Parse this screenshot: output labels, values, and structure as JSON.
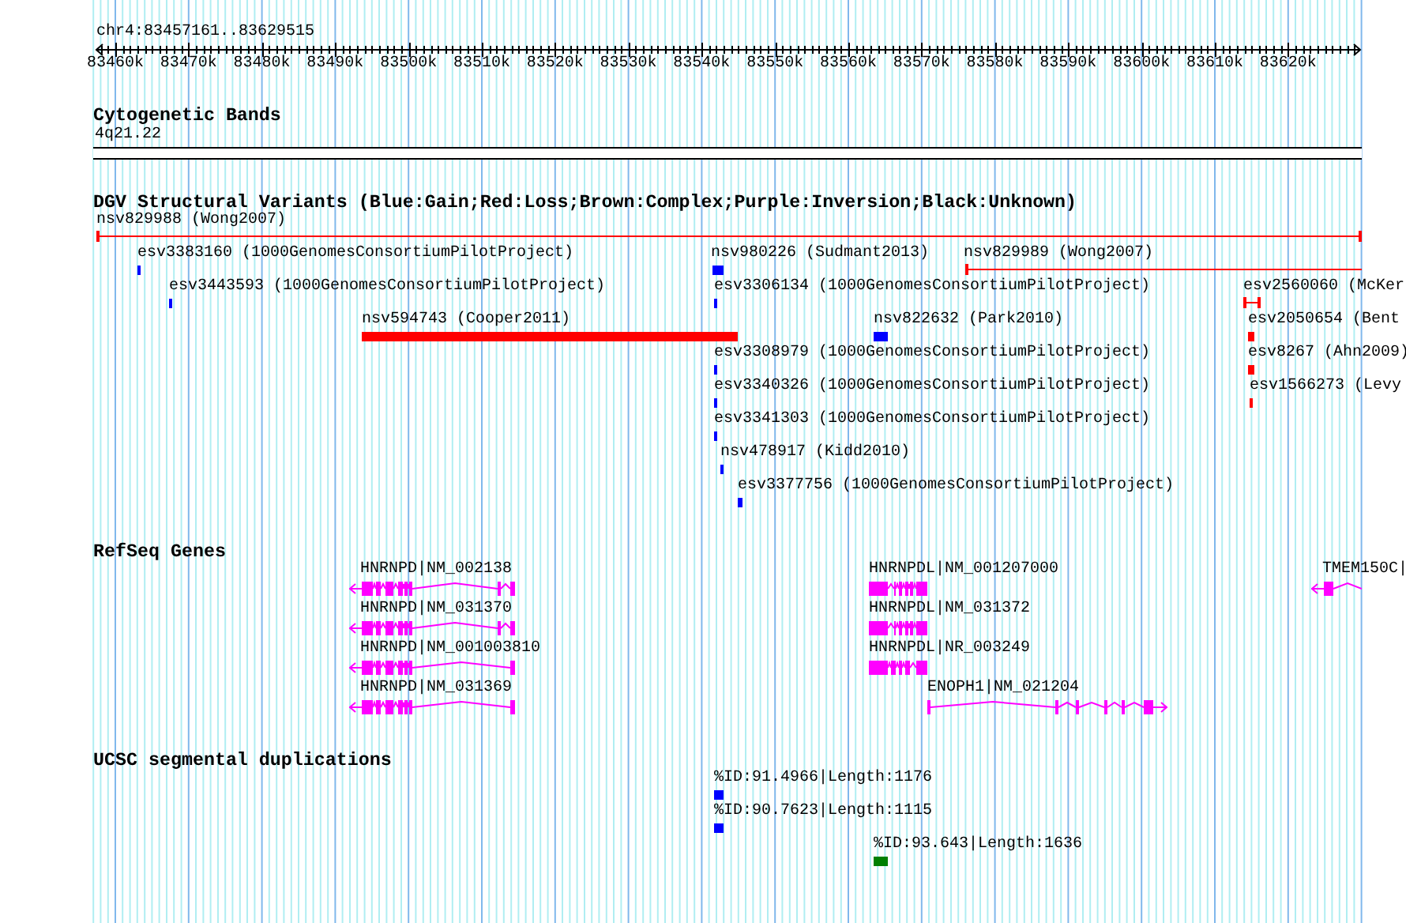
{
  "location": "chr4:83457161..83629515",
  "ruler": {
    "tick_labels": [
      "83460k",
      "83470k",
      "83480k",
      "83490k",
      "83500k",
      "83510k",
      "83520k",
      "83530k",
      "83540k",
      "83550k",
      "83560k",
      "83570k",
      "83580k",
      "83590k",
      "83600k",
      "83610k",
      "83620k"
    ]
  },
  "tracks": [
    {
      "kind": "cytoband",
      "title": "Cytogenetic Bands",
      "features": [
        {
          "label": "4q21.22"
        }
      ]
    },
    {
      "kind": "variants",
      "title": "DGV Structural Variants (Blue:Gain;Red:Loss;Brown:Complex;Purple:Inversion;Black:Unknown)",
      "features": [
        {
          "label": "nsv829988 (Wong2007)",
          "kind": "line",
          "color": "#ff0000"
        },
        {
          "label": "esv3383160 (1000GenomesConsortiumPilotProject)",
          "kind": "box",
          "color": "#0000ff"
        },
        {
          "label": "nsv980226 (Sudmant2013)",
          "kind": "box",
          "color": "#0000ff"
        },
        {
          "label": "nsv829989 (Wong2007)",
          "kind": "line",
          "color": "#ff0000"
        },
        {
          "label": "esv3443593 (1000GenomesConsortiumPilotProject)",
          "kind": "box",
          "color": "#0000ff"
        },
        {
          "label": "esv3306134 (1000GenomesConsortiumPilotProject)",
          "kind": "box",
          "color": "#0000ff"
        },
        {
          "label": "esv2560060 (McKer",
          "kind": "line",
          "color": "#ff0000"
        },
        {
          "label": "nsv594743 (Cooper2011)",
          "kind": "box",
          "color": "#ff0000"
        },
        {
          "label": "nsv822632 (Park2010)",
          "kind": "box",
          "color": "#0000ff"
        },
        {
          "label": "esv2050654 (Bent",
          "kind": "box",
          "color": "#ff0000"
        },
        {
          "label": "esv3308979 (1000GenomesConsortiumPilotProject)",
          "kind": "box",
          "color": "#0000ff"
        },
        {
          "label": "esv8267 (Ahn2009)",
          "kind": "box",
          "color": "#ff0000"
        },
        {
          "label": "esv3340326 (1000GenomesConsortiumPilotProject)",
          "kind": "box",
          "color": "#0000ff"
        },
        {
          "label": "esv1566273 (Levy",
          "kind": "box",
          "color": "#ff0000"
        },
        {
          "label": "esv3341303 (1000GenomesConsortiumPilotProject)",
          "kind": "box",
          "color": "#0000ff"
        },
        {
          "label": "nsv478917 (Kidd2010)",
          "kind": "box",
          "color": "#0000ff"
        },
        {
          "label": "esv3377756 (1000GenomesConsortiumPilotProject)",
          "kind": "box",
          "color": "#0000ff"
        }
      ]
    },
    {
      "kind": "genes",
      "title": "RefSeq Genes",
      "features": [
        {
          "label": "HNRNPD|NM_002138",
          "kind": "reverse"
        },
        {
          "label": "HNRNPD|NM_031370",
          "kind": "reverse"
        },
        {
          "label": "HNRNPD|NM_001003810",
          "kind": "reverse"
        },
        {
          "label": "HNRNPD|NM_031369",
          "kind": "reverse"
        },
        {
          "label": "HNRNPDL|NM_001207000",
          "kind": "unmarked"
        },
        {
          "label": "HNRNPDL|NM_031372",
          "kind": "unmarked"
        },
        {
          "label": "HNRNPDL|NR_003249",
          "kind": "unmarked"
        },
        {
          "label": "ENOPH1|NM_021204",
          "kind": "forward"
        },
        {
          "label": "TMEM150C|",
          "kind": "reverse"
        }
      ]
    },
    {
      "kind": "duplications",
      "title": "UCSC segmental duplications",
      "features": [
        {
          "label": "%ID:91.4966|Length:1176",
          "color": "#0000ff"
        },
        {
          "label": "%ID:90.7623|Length:1115",
          "color": "#0000ff"
        },
        {
          "label": "%ID:93.643|Length:1636",
          "color": "#008000"
        }
      ]
    }
  ]
}
